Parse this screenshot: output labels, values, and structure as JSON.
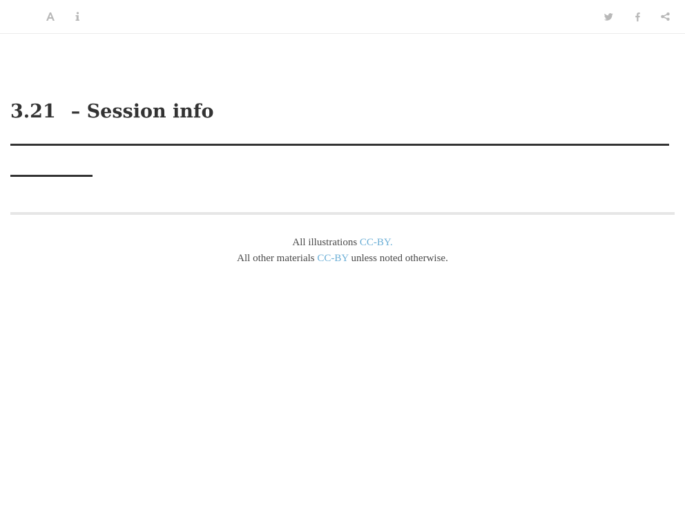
{
  "toolbar": {
    "left_icons": [
      "font-settings-icon",
      "info-icon"
    ],
    "right_icons": [
      "twitter-icon",
      "facebook-icon",
      "share-icon"
    ]
  },
  "chapter": {
    "number": "3.21",
    "title": "– Session info"
  },
  "footer": {
    "line1_prefix": "All illustrations ",
    "line1_link": "CC-BY.",
    "line2_prefix": "All other materials ",
    "line2_link": "CC-BY",
    "line2_suffix": " unless noted otherwise."
  },
  "colors": {
    "icon": "#b8b8b8",
    "link": "#6aaed6",
    "text": "#333333",
    "rule": "#e6e6e6"
  }
}
